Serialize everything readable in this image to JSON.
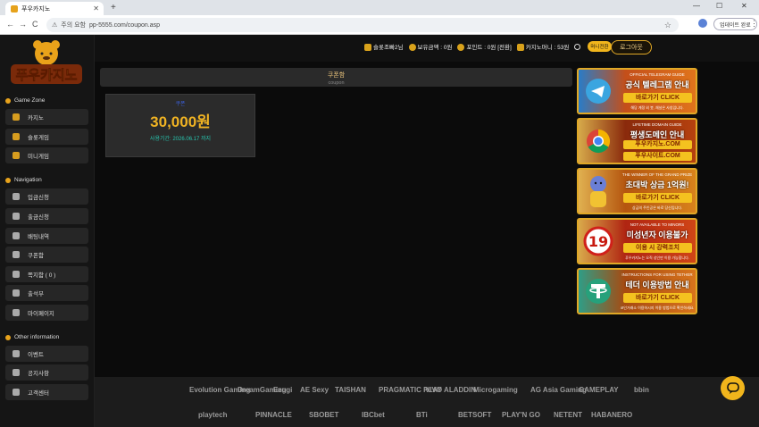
{
  "browser": {
    "tab_title": "푸우카지노",
    "url_warning": "주의 요함",
    "url": "pp-5555.com/coupon.asp",
    "reload_button": "업데이트 완료",
    "new_tab": "+",
    "back": "←",
    "forward": "→",
    "refresh": "C",
    "minimize": "—",
    "maximize": "☐",
    "close": "✕",
    "bookmark": "☆",
    "menu": "⋮"
  },
  "logo": {
    "text": "푸우카지노"
  },
  "header": {
    "username": "슬롯조빠2님",
    "balance": "보유금액 : 0원",
    "points": "포인트 : 0원",
    "convert": "[전환]",
    "casino_money": "카지노머니 : 53원",
    "convert_button": "머니전환",
    "logout": "로그아웃"
  },
  "sidebar": {
    "sections": [
      {
        "title": "Game Zone",
        "items": [
          "카지노",
          "슬롯게임",
          "미니게임"
        ]
      },
      {
        "title": "Navigation",
        "items": [
          "입금신청",
          "출금신청",
          "배팅내역",
          "쿠폰함",
          "쪽지함 ( 0 )",
          "출석부",
          "마이페이지"
        ]
      },
      {
        "title": "Other information",
        "items": [
          "이벤트",
          "공지사항",
          "고객센터"
        ]
      }
    ]
  },
  "page": {
    "title": "쿠폰함",
    "subtitle": "coupon"
  },
  "coupon": {
    "label": "쿠폰",
    "amount": "30,000원",
    "expiry": "사용기간: 2026.06.17 까지"
  },
  "banners": [
    {
      "small": "OFFICIAL TELEGRAM GUIDE",
      "big": "공식 텔레그램 안내",
      "cta": "바로가기 CLICK",
      "sub": "해당 계정 외 봇, 채널은 사칭입니다.",
      "color": "#c44f1a"
    },
    {
      "small": "LIFETIME DOMAIN GUIDE",
      "big": "평생도메인 안내",
      "cta": "푸우카지노.COM",
      "cta2": "푸우사이트.COM",
      "color": "#8a2a0c"
    },
    {
      "small": "THE WINNER OF THE GRAND PRIZE",
      "big": "초대박 상금 1억원!",
      "cta": "바로가기 CLICK",
      "sub": "상금의 주인공은 바로 당신입니다.",
      "color": "#b5560f"
    },
    {
      "small": "NOT AVAILABLE TO MINORS",
      "big": "미성년자 이용불가",
      "cta": "이용 시 강력조치",
      "sub": "푸우카지노는 오직 성인만 이용 가능합니다.",
      "color": "#b02512"
    },
    {
      "small": "INSTRUCTIONS FOR USING TETHER",
      "big": "테더 이용방법 안내",
      "cta": "바로가기 CLICK",
      "sub": "코인거래소 이용하시지 이용 방법으로 확인하세요.",
      "color": "#a84a10"
    }
  ],
  "providers_row1": [
    "Evolution Gaming",
    "DreamGaming",
    "Ezugi",
    "AE Sexy",
    "TAISHAN",
    "PRAGMATIC PLAY",
    "VIVO ALADDIN",
    "Microgaming",
    "AG Asia Gaming",
    "GAMEPLAY",
    "bbin"
  ],
  "providers_row2": [
    "playtech",
    "PINNACLE",
    "SBOBET",
    "IBCbet",
    "BTi",
    "BETSOFT",
    "PLAY'N GO",
    "NETENT",
    "HABANERO"
  ]
}
